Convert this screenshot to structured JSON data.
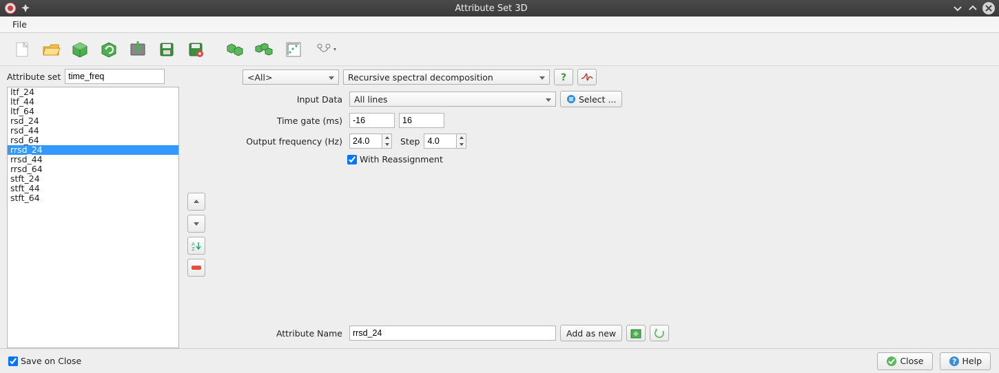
{
  "window": {
    "title": "Attribute Set 3D"
  },
  "menubar": {
    "file": "File"
  },
  "attr_set": {
    "label": "Attribute set",
    "value": "time_freq"
  },
  "list": {
    "items": [
      "ltf_24",
      "ltf_44",
      "ltf_64",
      "rsd_24",
      "rsd_44",
      "rsd_64",
      "rrsd_24",
      "rrsd_44",
      "rrsd_64",
      "stft_24",
      "stft_44",
      "stft_64"
    ],
    "selected_index": 6
  },
  "filter_combo": "<All>",
  "method_combo": "Recursive spectral decomposition",
  "input_data": {
    "label": "Input Data",
    "value": "All lines",
    "select_btn": "Select ..."
  },
  "time_gate": {
    "label": "Time gate (ms)",
    "from": "-16",
    "to": "16"
  },
  "out_freq": {
    "label": "Output frequency (Hz)",
    "value": "24.0",
    "step_label": "Step",
    "step_value": "4.0"
  },
  "reassign": {
    "label": "With Reassignment",
    "checked": true
  },
  "attr_name": {
    "label": "Attribute Name",
    "value": "rrsd_24",
    "add_btn": "Add as new"
  },
  "footer": {
    "save_on_close": "Save on Close",
    "save_checked": true,
    "close": "Close",
    "help": "Help"
  }
}
